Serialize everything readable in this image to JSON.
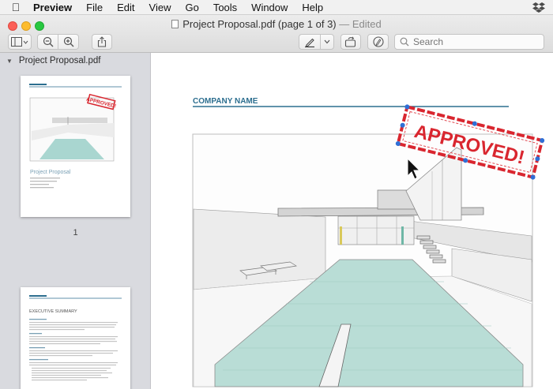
{
  "menubar": {
    "apple_icon": "apple-icon",
    "app_name": "Preview",
    "items": [
      "File",
      "Edit",
      "View",
      "Go",
      "Tools",
      "Window",
      "Help"
    ],
    "status_icon": "dropbox-icon"
  },
  "window": {
    "title": "Project Proposal.pdf (page 1 of 3)",
    "edited_label": "— Edited"
  },
  "toolbar": {
    "sidebar_icon": "sidebar-toggle-icon",
    "zoom_out_icon": "zoom-out-icon",
    "zoom_in_icon": "zoom-in-icon",
    "share_icon": "share-icon",
    "markup_icon": "pen-icon",
    "rotate_icon": "rotate-icon",
    "annotate_icon": "markup-toolbar-icon",
    "search_placeholder": "Search"
  },
  "sidebar": {
    "title": "Project Proposal.pdf",
    "pages": [
      {
        "number": "1",
        "heading": "Project Proposal"
      },
      {
        "number": "",
        "heading": "EXECUTIVE SUMMARY"
      }
    ]
  },
  "document": {
    "company_name": "COMPANY NAME",
    "stamp_text": "APPROVED!",
    "accent_color": "#2c6e8f",
    "stamp_color": "#d9262f"
  }
}
